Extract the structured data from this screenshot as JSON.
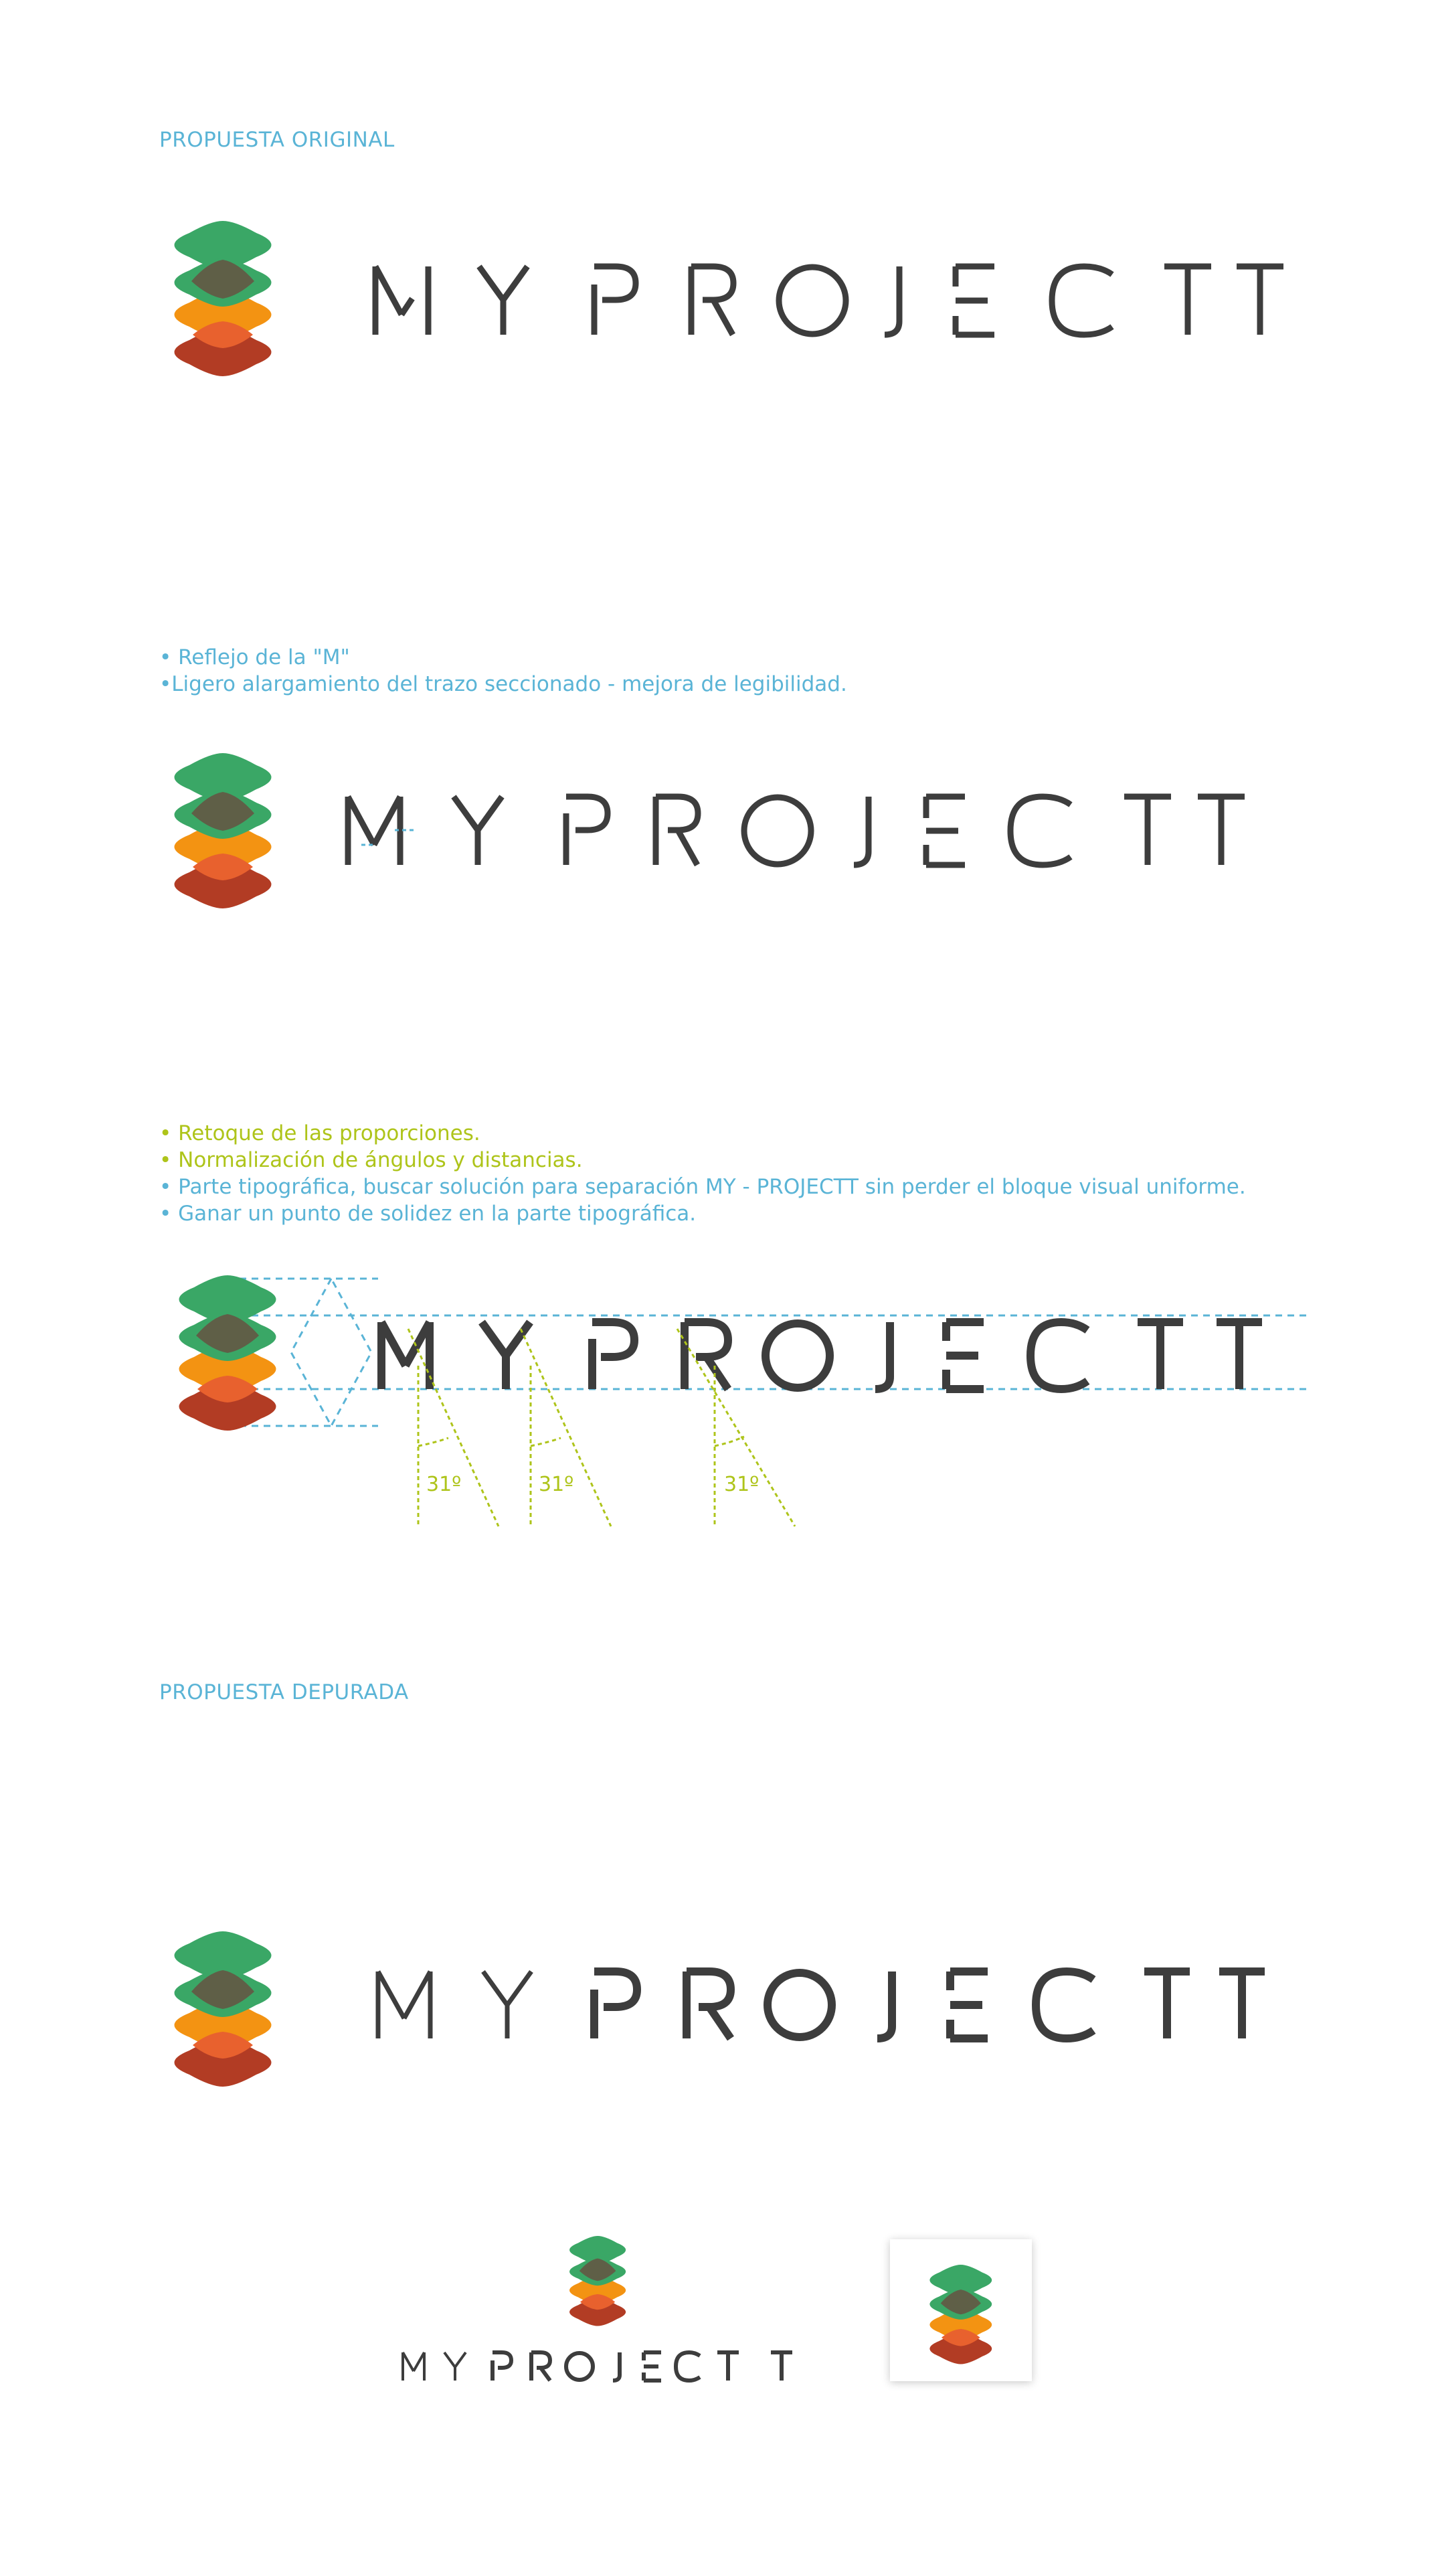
{
  "sections": {
    "original_label": "PROPUESTA ORIGINAL",
    "refined_label": "PROPUESTA DEPURADA"
  },
  "notes_v2": [
    "• Reflejo de la \"M\"",
    "•Ligero alargamiento del trazo seccionado - mejora de legibilidad."
  ],
  "notes_v3": [
    "• Retoque de las proporciones.",
    "• Normalización de ángulos y distancias.",
    "• Parte tipográfica, buscar solución para separación MY - PROJECTT sin perder el bloque visual uniforme.",
    "• Ganar un punto de solidez en la parte tipográfica."
  ],
  "angle_labels": [
    "31º",
    "31º",
    "31º"
  ],
  "brand": {
    "wordmark": "MYPROJECTT",
    "colors": {
      "green": "#3aa766",
      "overlap_dark": "#5f5f47",
      "orange": "#f39312",
      "overlap_red": "#e8612e",
      "rust": "#b23c24",
      "type": "#3d3d3d",
      "guide_blue": "#5ab4d6",
      "guide_lime": "#aec41a"
    }
  },
  "icons": [
    "layered-diamond-logo-icon"
  ]
}
